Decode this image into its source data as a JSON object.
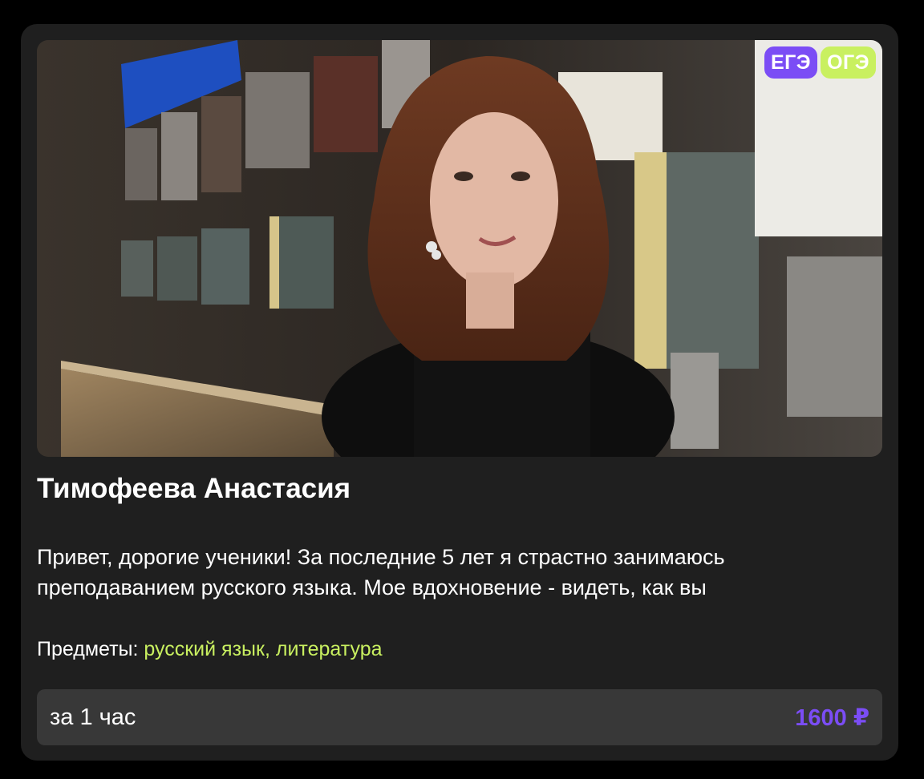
{
  "tutor": {
    "name": "Тимофеева Анастасия",
    "bio_line1": "Привет, дорогие ученики! За последние 5 лет я страстно занимаюсь",
    "bio_line2": "преподаванием русского языка. Мое вдохновение - видеть, как вы",
    "subjects_label": "Предметы:",
    "subjects_value": "русский язык, литература",
    "photo_alt": "tutor-portrait"
  },
  "badges": {
    "ege": "ЕГЭ",
    "oge": "ОГЭ"
  },
  "price": {
    "unit": "за 1 час",
    "value": "1600 ₽"
  },
  "colors": {
    "card_bg": "#1f1f1f",
    "accent_purple": "#7b4df5",
    "accent_lime": "#c9f060",
    "price_bar_bg": "#383838"
  }
}
